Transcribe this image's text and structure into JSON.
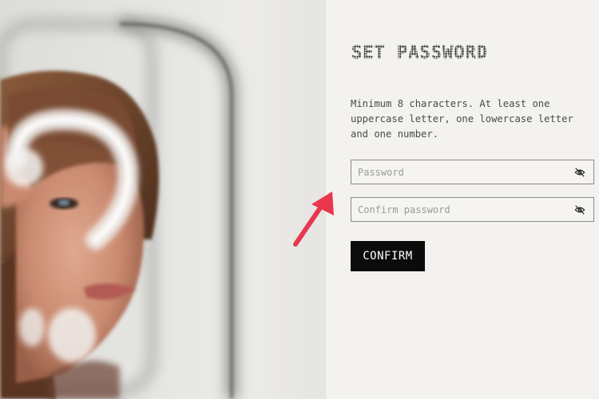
{
  "page": {
    "title": "SET PASSWORD",
    "description": "Minimum 8 characters. At least one uppercase letter, one lowercase letter and one number."
  },
  "form": {
    "password": {
      "placeholder": "Password",
      "value": "",
      "toggle_icon": "eye-slash-icon"
    },
    "confirm_password": {
      "placeholder": "Confirm password",
      "value": "",
      "toggle_icon": "eye-slash-icon"
    },
    "confirm_button_label": "CONFIRM"
  },
  "annotation": {
    "icon": "red-arrow-icon",
    "color": "#e8374f"
  },
  "colors": {
    "button_bg": "#0b0b0b",
    "panel_bg": "#f3f2ef",
    "field_border": "#8a8a88"
  }
}
